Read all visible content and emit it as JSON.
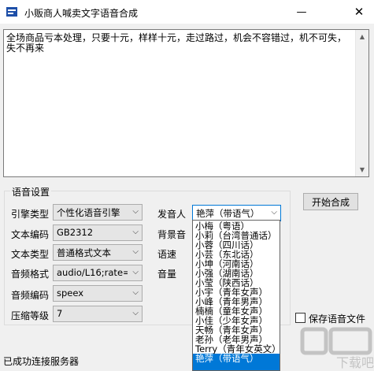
{
  "window": {
    "title": "小贩商人喊卖文字语音合成"
  },
  "editor": {
    "text": "全场商品亏本处理，只要十元，样样十元，走过路过，机会不容错过，机不可失，失不再来"
  },
  "settings": {
    "group_title": "语音设置",
    "engine": {
      "label": "引擎类型",
      "value": "个性化语音引擎"
    },
    "encoding": {
      "label": "文本编码",
      "value": "GB2312"
    },
    "text_type": {
      "label": "文本类型",
      "value": "普通格式文本"
    },
    "audio_format": {
      "label": "音频格式",
      "value": "audio/L16;rate="
    },
    "audio_codec": {
      "label": "音频编码",
      "value": "speex"
    },
    "compression": {
      "label": "压缩等级",
      "value": "7"
    },
    "speaker": {
      "label": "发音人",
      "value": "艳萍（带语气）"
    },
    "bg_sound": {
      "label": "背景音"
    },
    "speed": {
      "label": "语速"
    },
    "volume": {
      "label": "音量"
    }
  },
  "voice_options": [
    "小梅（粤语）",
    "小莉（台湾普通话）",
    "小蓉（四川话）",
    "小芸（东北话）",
    "小坤（河南话）",
    "小强（湖南话）",
    "小莹（陕西话）",
    "小宇（青年女声）",
    "小峰（青年男声）",
    "楠楠（童年女声）",
    "小佳（少年女声）",
    "天畅（青年女声）",
    "老孙（老年男声）",
    "Terry（青年女英文）",
    "艳萍（带语气）"
  ],
  "buttons": {
    "start": "开始合成"
  },
  "save_audio": {
    "label": "保存语音文件",
    "checked": false
  },
  "status": "已成功连接服务器",
  "watermark": "下载吧"
}
